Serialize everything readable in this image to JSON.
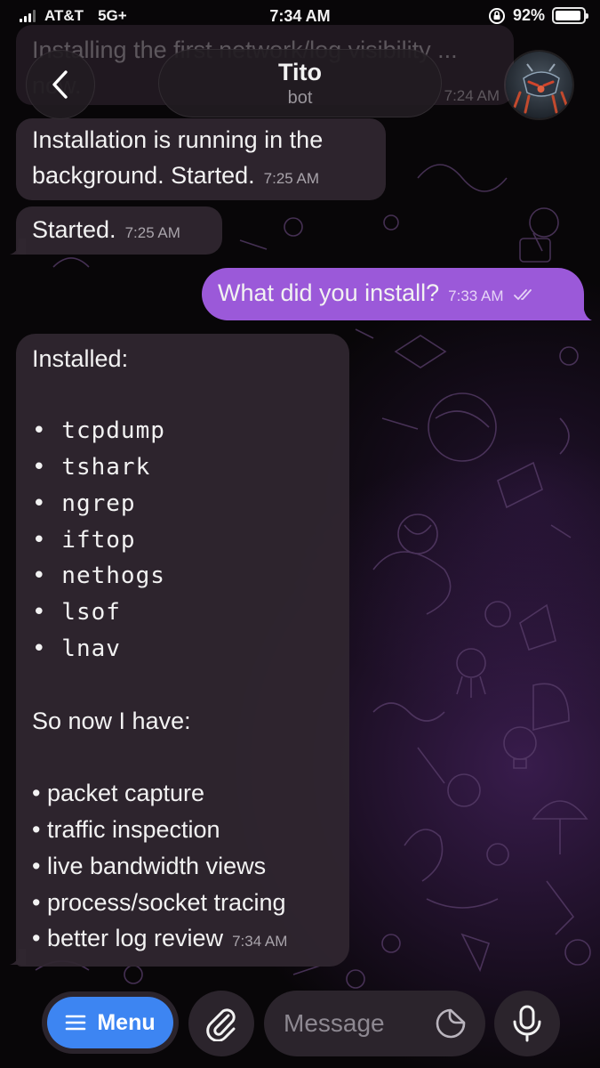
{
  "status_bar": {
    "carrier": "AT&T",
    "network": "5G+",
    "time": "7:34 AM",
    "battery": "92%",
    "battery_level": 0.92
  },
  "header": {
    "title": "Tito",
    "subtitle": "bot",
    "back_icon": "chevron-left-icon",
    "avatar_icon": "robot-avatar"
  },
  "previous_message": {
    "text": "Installing the first network/log visibility ... now.",
    "time": "7:24 AM"
  },
  "messages": [
    {
      "direction": "incoming",
      "lines": [
        "Installation is running in the",
        "background. Started."
      ],
      "time": "7:25 AM"
    },
    {
      "direction": "incoming",
      "text": "Started.",
      "time": "7:25 AM"
    },
    {
      "direction": "outgoing",
      "text": "What did you install?",
      "time": "7:33 AM",
      "status_icon": "double-check-icon"
    },
    {
      "direction": "incoming",
      "heading": "Installed:",
      "tools": [
        "• tcpdump",
        "• tshark",
        "• ngrep",
        "• iftop",
        "• nethogs",
        "• lsof",
        "• lnav"
      ],
      "subheading": "So now I have:",
      "capabilities": [
        "• packet capture",
        "• traffic inspection",
        "• live bandwidth views",
        "• process/socket tracing",
        "• better log review"
      ],
      "time": "7:34 AM"
    }
  ],
  "composer": {
    "menu_label": "Menu",
    "placeholder": "Message",
    "attach_icon": "paperclip-icon",
    "sticker_icon": "sticker-icon",
    "mic_icon": "microphone-icon"
  },
  "colors": {
    "outgoing_bubble": "#9b59d9",
    "incoming_bubble": "#30262f",
    "menu_button": "#3d85f2"
  }
}
